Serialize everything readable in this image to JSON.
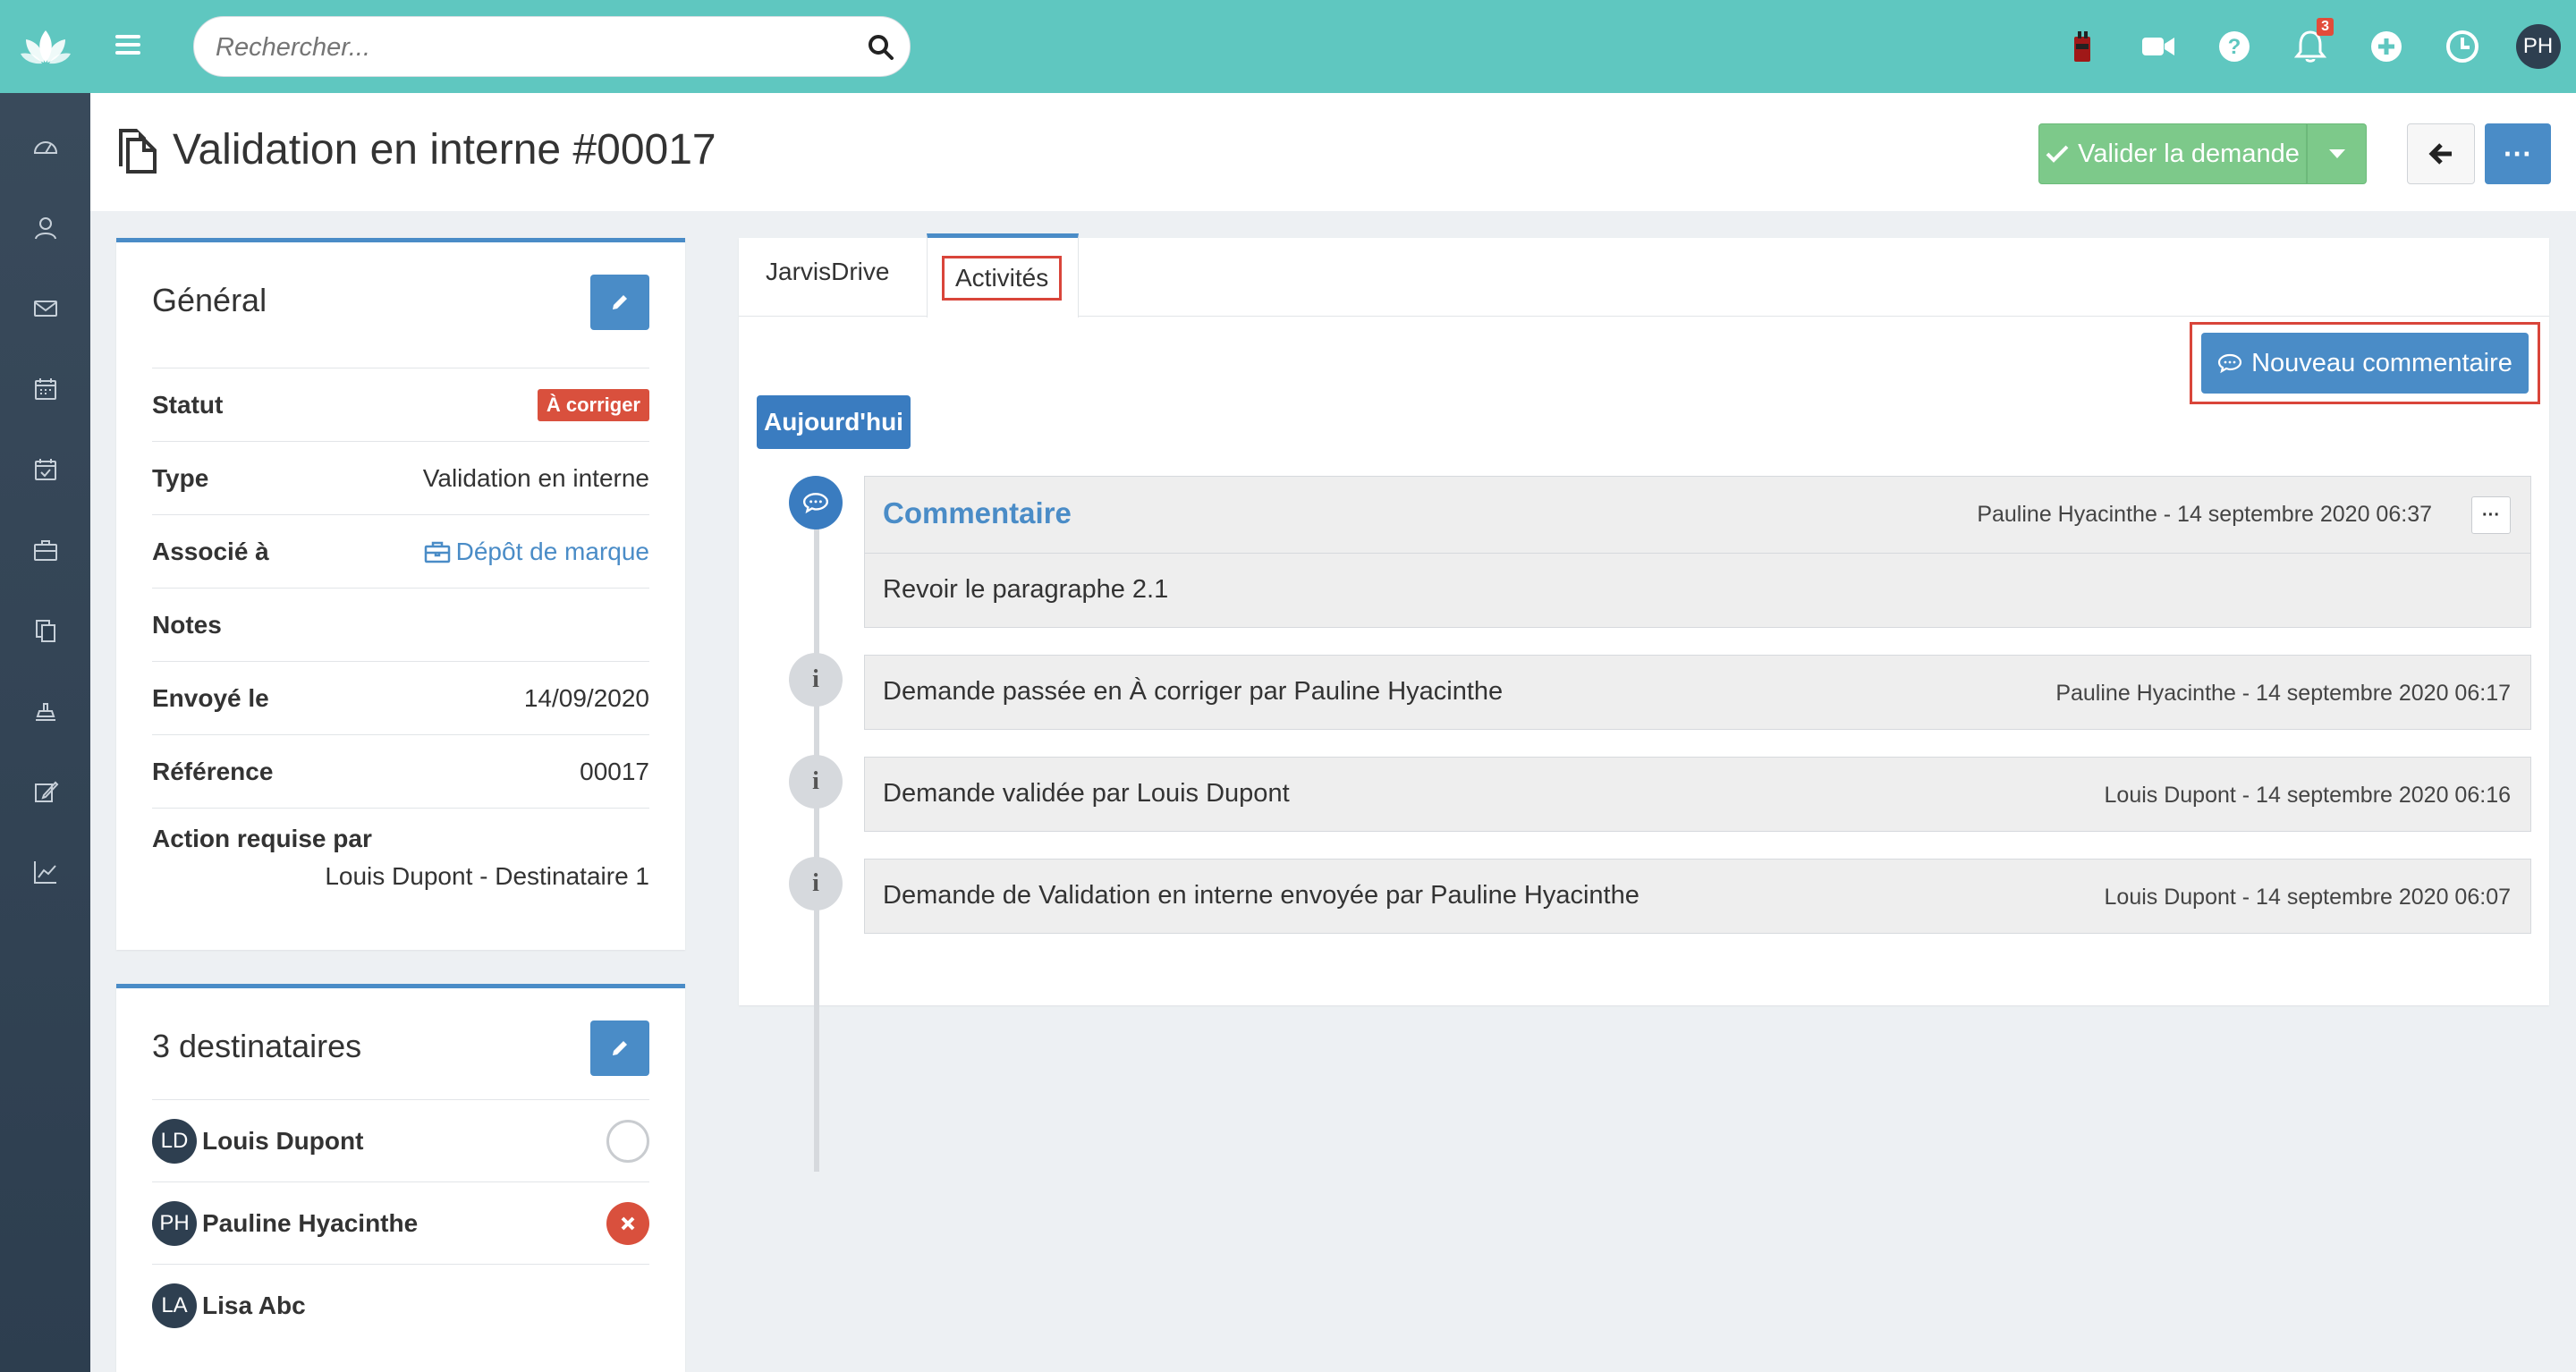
{
  "search": {
    "placeholder": "Rechercher..."
  },
  "topbar": {
    "notification_count": "3",
    "user_initials": "PH"
  },
  "page": {
    "title": "Validation en interne #00017"
  },
  "actions": {
    "validate_label": "Valider la demande",
    "more_label": "···"
  },
  "general": {
    "heading": "Général",
    "rows": [
      {
        "key": "Statut",
        "value": "À corriger"
      },
      {
        "key": "Type",
        "value": "Validation en interne"
      },
      {
        "key": "Associé à",
        "value": "Dépôt de marque"
      },
      {
        "key": "Notes",
        "value": ""
      },
      {
        "key": "Envoyé le",
        "value": "14/09/2020"
      },
      {
        "key": "Référence",
        "value": "00017"
      },
      {
        "key": "Action requise par",
        "value": "Louis Dupont - Destinataire 1"
      }
    ]
  },
  "recipients": {
    "heading": "3 destinataires",
    "items": [
      {
        "initials": "LD",
        "name": "Louis Dupont",
        "status": "pending"
      },
      {
        "initials": "PH",
        "name": "Pauline Hyacinthe",
        "status": "rejected"
      },
      {
        "initials": "LA",
        "name": "Lisa Abc",
        "status": "none"
      }
    ]
  },
  "tabs": [
    {
      "label": "JarvisDrive"
    },
    {
      "label": "Activités"
    }
  ],
  "activity": {
    "new_comment_label": "Nouveau commentaire",
    "today_label": "Aujourd'hui",
    "comment": {
      "title": "Commentaire",
      "meta": "Pauline Hyacinthe - 14 septembre 2020 06:37",
      "body": "Revoir le paragraphe 2.1"
    },
    "events": [
      {
        "text": "Demande passée en À corriger par Pauline Hyacinthe",
        "meta": "Pauline Hyacinthe - 14 septembre 2020 06:17"
      },
      {
        "text": "Demande validée par Louis Dupont",
        "meta": "Louis Dupont - 14 septembre 2020 06:16"
      },
      {
        "text": "Demande de Validation en interne envoyée par Pauline Hyacinthe",
        "meta": "Louis Dupont - 14 septembre 2020 06:07"
      }
    ]
  },
  "colors": {
    "topbar": "#5fc7c0",
    "primary": "#4a8cc7",
    "success": "#7dc98a",
    "danger": "#d9503d",
    "sidebar": "#2d3e4f"
  },
  "icons": {
    "sidebar": [
      "dashboard-icon",
      "contacts-icon",
      "mail-icon",
      "calendar-icon",
      "calendar-check-icon",
      "briefcase-icon",
      "documents-icon",
      "stamp-icon",
      "edit-icon",
      "chart-icon"
    ],
    "topbar": [
      "extension-icon",
      "video-icon",
      "help-icon",
      "bell-icon",
      "add-icon",
      "clock-icon"
    ]
  }
}
